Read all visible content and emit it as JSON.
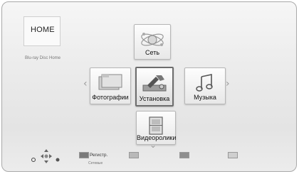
{
  "home": {
    "label": "HOME",
    "device_name": "Blu-ray Disc Home"
  },
  "menu": {
    "top": {
      "label": "Сеть",
      "icon": "network-icon"
    },
    "left": {
      "label": "Фотографии",
      "icon": "photos-folder-icon"
    },
    "center": {
      "label": "Установка",
      "icon": "setup-tools-icon"
    },
    "right": {
      "label": "Музыка",
      "icon": "music-note-icon"
    },
    "bottom": {
      "label": "Видеоролики",
      "icon": "video-film-icon"
    }
  },
  "hints": {
    "dpad_icon": "dpad-navigation-icon",
    "keys": [
      {
        "color": "#7a7a7a",
        "label": "Регистр.",
        "sub": "Сетевые"
      },
      {
        "color": "#b9b9b9",
        "label": "",
        "sub": ""
      },
      {
        "color": "#8e8e8e",
        "label": "",
        "sub": ""
      },
      {
        "color": "#cfcfcf",
        "label": "",
        "sub": ""
      }
    ]
  }
}
